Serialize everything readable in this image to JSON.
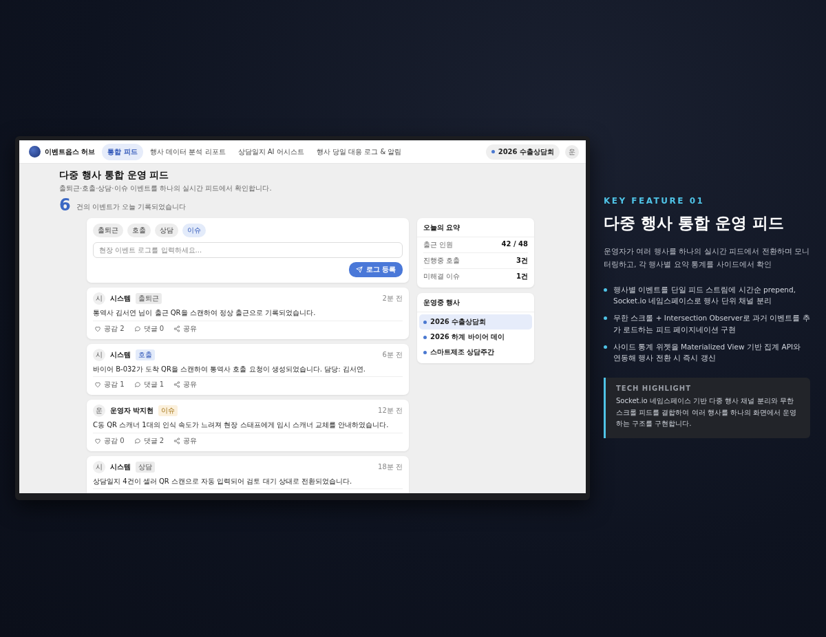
{
  "app": {
    "brand": "이벤트옵스 허브",
    "nav": [
      {
        "label": "통합 피드",
        "selected": true
      },
      {
        "label": "행사 데이터 분석 리포트",
        "selected": false
      },
      {
        "label": "상담일지 AI 어시스트",
        "selected": false
      },
      {
        "label": "행사 당일 대응 로그 & 알림",
        "selected": false
      }
    ],
    "current_event": "2026 수출상담회",
    "avatar": "운",
    "page_title": "다중 행사 통합 운영 피드",
    "page_subtitle": "출퇴근·호출·상담·이슈 이벤트를 하나의 실시간 피드에서 확인합니다.",
    "count": "6",
    "count_label": "건의 이벤트가 오늘 기록되었습니다",
    "composer": {
      "filters": [
        {
          "label": "출퇴근",
          "selected": false
        },
        {
          "label": "호출",
          "selected": false
        },
        {
          "label": "상담",
          "selected": false
        },
        {
          "label": "이슈",
          "selected": true
        }
      ],
      "placeholder": "현장 이벤트 로그를 입력하세요...",
      "submit": "로그 등록"
    },
    "posts": [
      {
        "avatar": "시",
        "author": "시스템",
        "tag": "출퇴근",
        "kind": "attendance",
        "time": "2분 전",
        "body": "통역사 김서연 님이 출근 QR을 스캔하여 정상 출근으로 기록되었습니다.",
        "like": "공감 2",
        "comment": "댓글 0",
        "share": "공유"
      },
      {
        "avatar": "시",
        "author": "시스템",
        "tag": "호출",
        "kind": "call",
        "time": "6분 전",
        "body": "바이어 B-032가 도착 QR을 스캔하여 통역사 호출 요청이 생성되었습니다. 담당: 김서연.",
        "like": "공감 1",
        "comment": "댓글 1",
        "share": "공유"
      },
      {
        "avatar": "운",
        "author": "운영자 박지현",
        "tag": "이슈",
        "kind": "issue",
        "time": "12분 전",
        "body": "C동 QR 스캐너 1대의 인식 속도가 느려져 현장 스태프에게 임시 스캐너 교체를 안내하였습니다.",
        "like": "공감 0",
        "comment": "댓글 2",
        "share": "공유"
      },
      {
        "avatar": "시",
        "author": "시스템",
        "tag": "상담",
        "kind": "consult",
        "time": "18분 전",
        "body": "상담일지 4건이 셀러 QR 스캔으로 자동 입력되어 검토 대기 상태로 전환되었습니다."
      }
    ],
    "summary": {
      "title": "오늘의 요약",
      "rows": [
        {
          "label": "출근 인원",
          "value": "42 / 48"
        },
        {
          "label": "진행중 호출",
          "value": "3건"
        },
        {
          "label": "미해결 이슈",
          "value": "1건"
        }
      ]
    },
    "events": {
      "title": "운영중 행사",
      "items": [
        {
          "label": "2026 수출상담회",
          "selected": true
        },
        {
          "label": "2026 하계 바이어 데이",
          "selected": false
        },
        {
          "label": "스마트제조 상담주간",
          "selected": false
        }
      ]
    }
  },
  "feature": {
    "eyebrow": "KEY FEATURE 01",
    "title": "다중 행사 통합 운영 피드",
    "description": "운영자가 여러 행사를 하나의 실시간 피드에서 전환하며 모니터링하고, 각 행사별 요약 통계를 사이드에서 확인",
    "bullets": [
      "행사별 이벤트를 단일 피드 스트림에 시간순 prepend, Socket.io 네임스페이스로 행사 단위 채널 분리",
      "무한 스크롤 + Intersection Observer로 과거 이벤트를 추가 로드하는 피드 페이지네이션 구현",
      "사이드 통계 위젯을 Materialized View 기반 집계 API와 연동해 행사 전환 시 즉시 갱신"
    ],
    "highlight": {
      "title": "TECH HIGHLIGHT",
      "body": "Socket.io 네임스페이스 기반 다중 행사 채널 분리와 무한 스크롤 피드를 결합하여 여러 행사를 하나의 화면에서 운영하는 구조를 구현합니다."
    }
  }
}
